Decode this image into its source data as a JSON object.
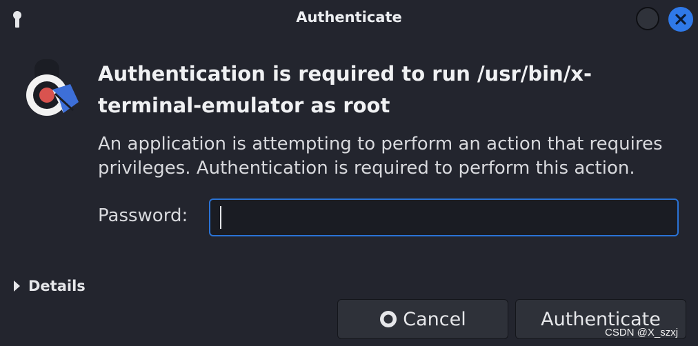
{
  "window": {
    "title": "Authenticate"
  },
  "dialog": {
    "heading": "Authentication is required to run /usr/bin/x-terminal-emulator as root",
    "description": "An application is attempting to perform an action that requires privileges. Authentication is required to perform this action.",
    "password_label": "Password:",
    "password_value": "",
    "details_label": "Details"
  },
  "buttons": {
    "cancel_label": "Cancel",
    "authenticate_label": "Authenticate"
  },
  "watermark": "CSDN @X_szxj",
  "icons": {
    "title": "keyhole-icon",
    "app": "kali-terminal-auth-icon",
    "cancel": "cancel-circle-icon",
    "close": "close-icon",
    "minimize": "minimize-icon"
  },
  "colors": {
    "background": "#23252e",
    "accent": "#2a73d6",
    "close_button": "#2f79e8"
  }
}
